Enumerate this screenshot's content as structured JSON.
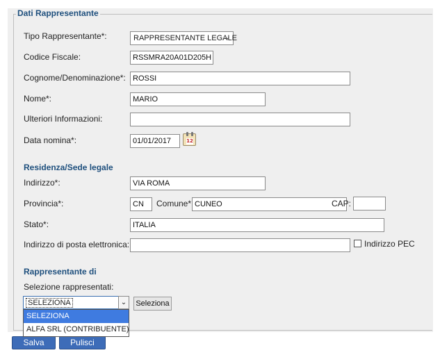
{
  "form": {
    "legend": "Dati Rappresentante",
    "tipo": {
      "label": "Tipo Rappresentante*:",
      "value": "RAPPRESENTANTE LEGALE"
    },
    "codice_fiscale": {
      "label": "Codice Fiscale:",
      "value": "RSSMRA20A01D205H"
    },
    "cognome": {
      "label": "Cognome/Denominazione*:",
      "value": "ROSSI"
    },
    "nome": {
      "label": "Nome*:",
      "value": "MARIO"
    },
    "ulteriori": {
      "label": "Ulteriori Informazioni:",
      "value": ""
    },
    "data_nomina": {
      "label": "Data nomina*:",
      "value": "01/01/2017",
      "calendar_icon_day": "12"
    }
  },
  "residenza": {
    "title": "Residenza/Sede legale",
    "indirizzo": {
      "label": "Indirizzo*:",
      "value": "VIA ROMA"
    },
    "provincia": {
      "label": "Provincia*:",
      "value": "CN"
    },
    "comune": {
      "label": "Comune*:",
      "value": "CUNEO"
    },
    "cap": {
      "label": "CAP:",
      "value": ""
    },
    "stato": {
      "label": "Stato*:",
      "value": "ITALIA"
    },
    "pec_address": {
      "label": "Indirizzo di posta elettronica:",
      "value": ""
    },
    "pec_checkbox_label": "Indirizzo PEC"
  },
  "rappresentante_di": {
    "title": "Rappresentante di",
    "selezione_label": "Selezione rappresentati:",
    "selected": "SELEZIONA",
    "options": [
      "SELEZIONA",
      "ALFA SRL (CONTRIBUENTE)"
    ],
    "seleziona_button": "Seleziona"
  },
  "actions": {
    "salva": "Salva",
    "pulisci": "Pulisci"
  }
}
